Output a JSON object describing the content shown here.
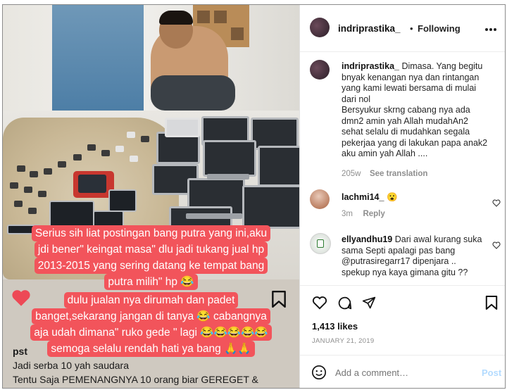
{
  "photo": {
    "caption_lines": [
      "Serius sih liat postingan bang putra yang ini,aku",
      "jdi bener\" keingat masa\" dlu jadi tukang jual hp",
      "2013-2015 yang sering datang ke tempat bang",
      "putra milih\" hp 😂",
      "dulu jualan nya dirumah dan padet",
      "banget,sekarang jangan di tanya 😂 cabangnya",
      "aja udah dimana\" ruko gede \" lagi 😂😂😂😂😂",
      "semoga selalu rendah hati ya bang 🙏🙏"
    ],
    "partial_username": "pst",
    "below_lines": [
      "Jadi serba 10 yah saudara",
      "Tentu Saja PEMENANGNYA 10 orang biar GEREGET &"
    ]
  },
  "header": {
    "username": "indriprastika_",
    "separator": "•",
    "follow_label": "Following",
    "more_icon": "more-horizontal-icon"
  },
  "post_caption": {
    "username": "indriprastika_",
    "text_lines": [
      "Dimasa. Yang begitu",
      "bnyak kenangan nya dan rintangan",
      "yang kami lewati bersama di mulai",
      "dari nol",
      "Bersyukur skrng cabang nya ada",
      "dmn2 amin yah Allah mudahAn2",
      "sehat selalu di mudahkan segala",
      "pekerjaa yang di lakukan papa anak2",
      "aku amin yah Allah ...."
    ],
    "age": "205w",
    "see_translation": "See translation"
  },
  "comments": [
    {
      "username": "lachmi14_",
      "text": "😮",
      "age": "3m",
      "reply_label": "Reply"
    },
    {
      "username": "ellyandhu19",
      "text_lines": [
        "Dari awal kurang suka",
        "sama Septi apalagi pas bang",
        "@putrasiregarr17 dipenjara ..",
        "spekup nya kaya gimana gitu ??"
      ]
    }
  ],
  "actions": {
    "likes": "1,413 likes",
    "date": "JANUARY 21, 2019"
  },
  "comment_input": {
    "placeholder": "Add a comment…",
    "post_label": "Post"
  },
  "colors": {
    "caption_highlight": "#f2545b",
    "post_button": "#b3dbff",
    "meta_gray": "#8e8e8e"
  }
}
